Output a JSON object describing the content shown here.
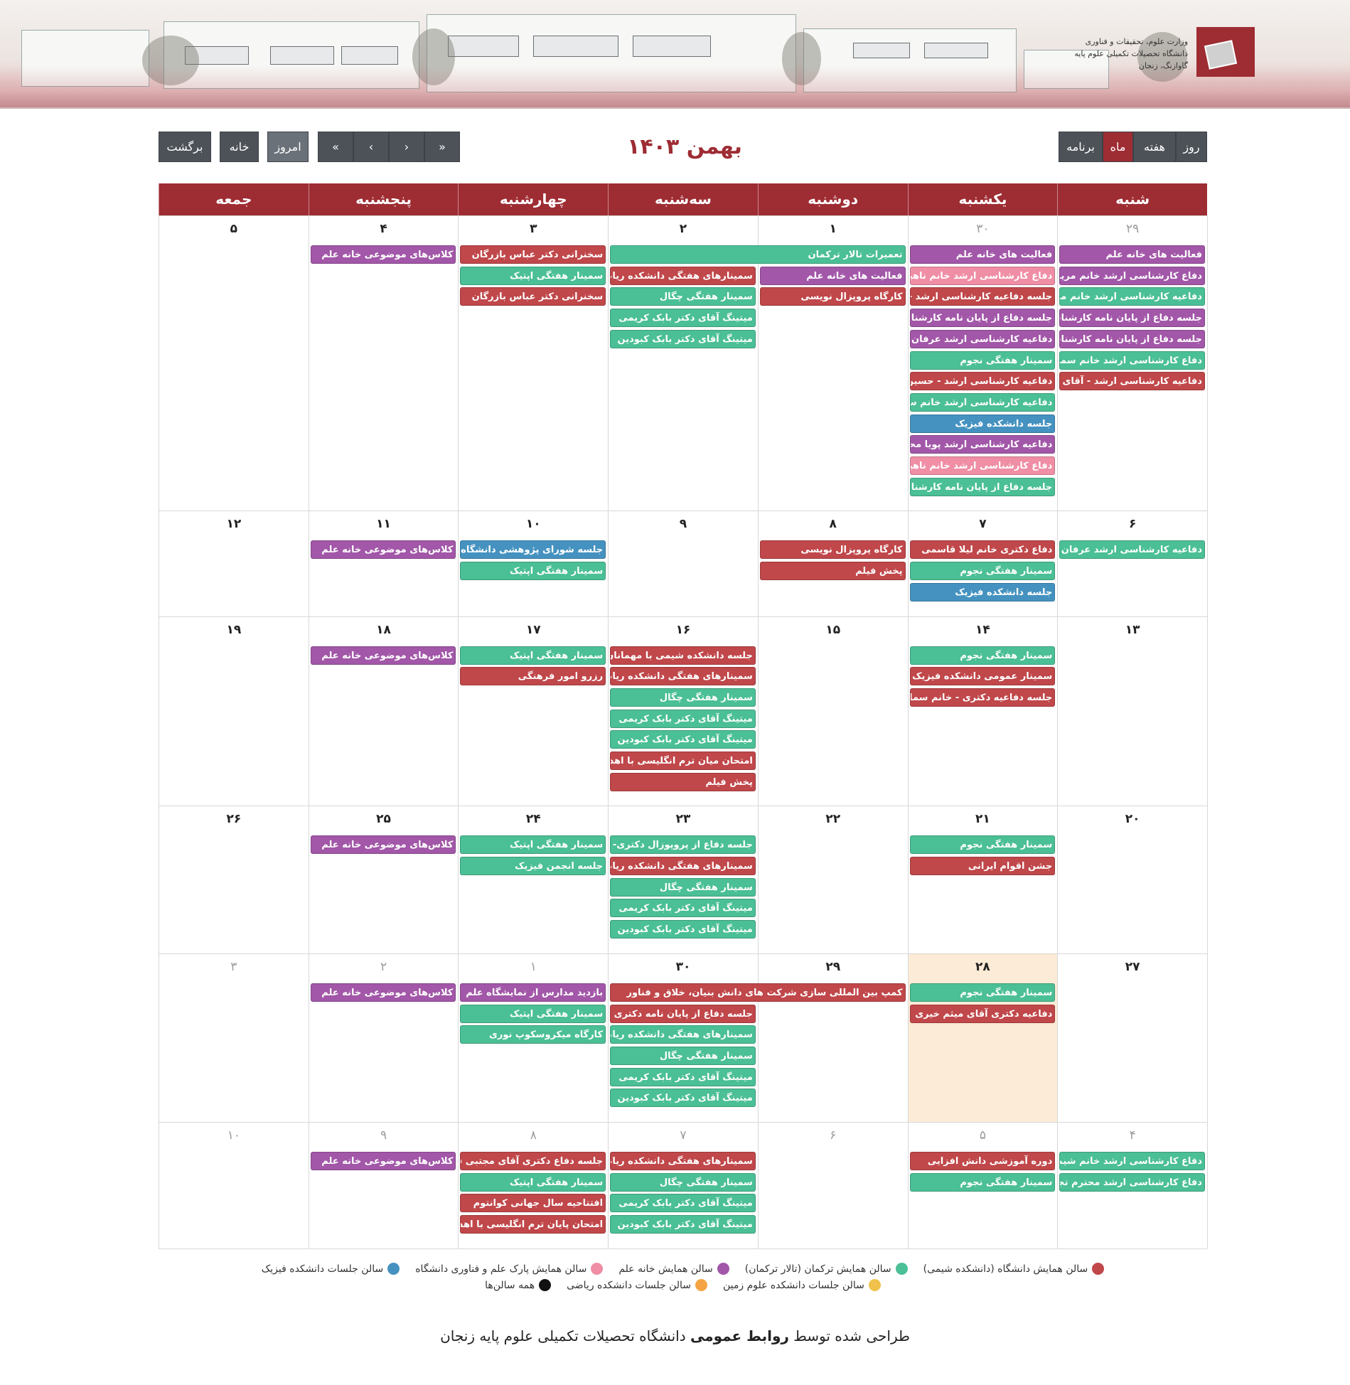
{
  "header": {
    "logo_lines": [
      "وزارت علوم، تحقیقات و فناوری",
      "دانشگاه تحصیلات تکمیلی علوم پایه",
      "گاوازنگ، زنجان"
    ]
  },
  "toolbar": {
    "views": [
      "روز",
      "هفته",
      "ماه",
      "برنامه"
    ],
    "active_view": "ماه",
    "title": "۱۴۰۳ بهمن",
    "nav": [
      "«",
      "‹",
      "›",
      "»"
    ],
    "today_label": "امروز",
    "home_label": "خانه",
    "back_label": "برگشت"
  },
  "calendar": {
    "weekdays": [
      "شنبه",
      "یکشنبه",
      "دوشنبه",
      "سه‌شنبه",
      "چهارشنبه",
      "پنجشنبه",
      "جمعه"
    ],
    "weeks": [
      {
        "days": [
          "۲۹",
          "۳۰",
          "۱",
          "۲",
          "۳",
          "۴",
          "۵"
        ],
        "other": [
          true,
          true,
          false,
          false,
          false,
          false,
          false
        ],
        "rows": 12,
        "events": [
          {
            "col": 0,
            "row": 0,
            "span": 1,
            "color": "purple",
            "text": "فعالیت های خانه علم"
          },
          {
            "col": 0,
            "row": 1,
            "span": 1,
            "color": "purple",
            "text": "دفاع کارشناسی ارشد خانم مریم حی"
          },
          {
            "col": 0,
            "row": 2,
            "span": 1,
            "color": "green",
            "text": "دفاعیه کارشناسی ارشد خانم مژگان"
          },
          {
            "col": 0,
            "row": 3,
            "span": 1,
            "color": "purple",
            "text": "جلسه دفاع از پایان نامه کارشناسی"
          },
          {
            "col": 0,
            "row": 4,
            "span": 1,
            "color": "purple",
            "text": "جلسه دفاع از پایان نامه کارشناسی"
          },
          {
            "col": 0,
            "row": 5,
            "span": 1,
            "color": "green",
            "text": "دفاع کارشناسی ارشد خانم سمیرا فت"
          },
          {
            "col": 0,
            "row": 6,
            "span": 1,
            "color": "red",
            "text": "دفاعیه کارشناسی ارشد - آقای احمد"
          },
          {
            "col": 1,
            "row": 0,
            "span": 1,
            "color": "purple",
            "text": "فعالیت های خانه علم"
          },
          {
            "col": 1,
            "row": 1,
            "span": 1,
            "color": "pink",
            "text": "دفاع کارشناسی ارشد خانم ناهید فر"
          },
          {
            "col": 1,
            "row": 2,
            "span": 1,
            "color": "red",
            "text": "جلسه دفاعیه کارشناسی ارشد - خان"
          },
          {
            "col": 1,
            "row": 3,
            "span": 1,
            "color": "purple",
            "text": "جلسه دفاع از پایان نامه کارشناسی"
          },
          {
            "col": 1,
            "row": 4,
            "span": 1,
            "color": "purple",
            "text": "دفاعیه کارشناسی ارشد عرفان محمد"
          },
          {
            "col": 1,
            "row": 5,
            "span": 1,
            "color": "green",
            "text": "سمینار هفتگی نجوم"
          },
          {
            "col": 1,
            "row": 6,
            "span": 1,
            "color": "red",
            "text": "دفاعیه کارشناسی ارشد - حسین اله"
          },
          {
            "col": 1,
            "row": 7,
            "span": 1,
            "color": "green",
            "text": "دفاعیه کارشناسی ارشد خانم سمیه"
          },
          {
            "col": 1,
            "row": 8,
            "span": 1,
            "color": "blue",
            "text": "جلسه دانشکده فیزیک"
          },
          {
            "col": 1,
            "row": 9,
            "span": 1,
            "color": "purple",
            "text": "دفاعیه کارشناسی ارشد پویا محمدی"
          },
          {
            "col": 1,
            "row": 10,
            "span": 1,
            "color": "pink",
            "text": "دفاع کارشناسی ارشد خانم ناهید فا"
          },
          {
            "col": 1,
            "row": 11,
            "span": 1,
            "color": "green",
            "text": "جلسه دفاع از پایان نامه کارشناسی"
          },
          {
            "col": 2,
            "row": 0,
            "span": 2,
            "color": "green",
            "text": "تعمیرات تالار ترکمان"
          },
          {
            "col": 2,
            "row": 1,
            "span": 1,
            "color": "purple",
            "text": "فعالیت های خانه علم"
          },
          {
            "col": 2,
            "row": 2,
            "span": 1,
            "color": "red",
            "text": "کارگاه پروپزال نویسی"
          },
          {
            "col": 3,
            "row": 1,
            "span": 1,
            "color": "red",
            "text": "سمینارهای هفتگی دانشکده ریاضی"
          },
          {
            "col": 3,
            "row": 2,
            "span": 1,
            "color": "green",
            "text": "سمینار هفتگی چگال"
          },
          {
            "col": 3,
            "row": 3,
            "span": 1,
            "color": "green",
            "text": "میتینگ آقای دکتر بابک کریمی"
          },
          {
            "col": 3,
            "row": 4,
            "span": 1,
            "color": "green",
            "text": "میتینگ آقای دکتر بابک کبودین"
          },
          {
            "col": 4,
            "row": 0,
            "span": 1,
            "color": "red",
            "text": "سخنرانی دکتر عباس بازرگان"
          },
          {
            "col": 4,
            "row": 1,
            "span": 1,
            "color": "green",
            "text": "سمینار هفتگی اپتیک"
          },
          {
            "col": 4,
            "row": 2,
            "span": 1,
            "color": "red",
            "text": "سخنرانی دکتر عباس بازرگان"
          },
          {
            "col": 5,
            "row": 0,
            "span": 1,
            "color": "purple",
            "text": "کلاس‌های موضوعی خانه علم"
          }
        ]
      },
      {
        "days": [
          "۶",
          "۷",
          "۸",
          "۹",
          "۱۰",
          "۱۱",
          "۱۲"
        ],
        "other": [
          false,
          false,
          false,
          false,
          false,
          false,
          false
        ],
        "rows": 3,
        "events": [
          {
            "col": 0,
            "row": 0,
            "span": 1,
            "color": "green",
            "text": "دفاعیه کارشناسی ارشد عرفان محمد"
          },
          {
            "col": 1,
            "row": 0,
            "span": 1,
            "color": "red",
            "text": "دفاع دکتری خانم لیلا قاسمی"
          },
          {
            "col": 1,
            "row": 1,
            "span": 1,
            "color": "green",
            "text": "سمینار هفتگی نجوم"
          },
          {
            "col": 1,
            "row": 2,
            "span": 1,
            "color": "blue",
            "text": "جلسه دانشکده فیزیک"
          },
          {
            "col": 2,
            "row": 0,
            "span": 1,
            "color": "red",
            "text": "کارگاه پروپزال نویسی"
          },
          {
            "col": 2,
            "row": 1,
            "span": 1,
            "color": "red",
            "text": "پخش فیلم"
          },
          {
            "col": 4,
            "row": 0,
            "span": 1,
            "color": "blue",
            "text": "جلسه شورای پژوهشی دانشگاه"
          },
          {
            "col": 4,
            "row": 1,
            "span": 1,
            "color": "green",
            "text": "سمینار هفتگی اپتیک"
          },
          {
            "col": 5,
            "row": 0,
            "span": 1,
            "color": "purple",
            "text": "کلاس‌های موضوعی خانه علم"
          }
        ]
      },
      {
        "days": [
          "۱۳",
          "۱۴",
          "۱۵",
          "۱۶",
          "۱۷",
          "۱۸",
          "۱۹"
        ],
        "other": [
          false,
          false,
          false,
          false,
          false,
          false,
          false
        ],
        "rows": 7,
        "events": [
          {
            "col": 1,
            "row": 0,
            "span": 1,
            "color": "green",
            "text": "سمینار هفتگی نجوم"
          },
          {
            "col": 1,
            "row": 1,
            "span": 1,
            "color": "red",
            "text": "سمینار عمومی دانشکده فیزیک"
          },
          {
            "col": 1,
            "row": 2,
            "span": 1,
            "color": "red",
            "text": "جلسه دفاعیه دکتری - خانم سمانه"
          },
          {
            "col": 3,
            "row": 0,
            "span": 1,
            "color": "red",
            "text": "جلسه دانشکده شیمی با مهمانان م"
          },
          {
            "col": 3,
            "row": 1,
            "span": 1,
            "color": "red",
            "text": "سمینارهای هفتگی دانشکده ریاضی"
          },
          {
            "col": 3,
            "row": 2,
            "span": 1,
            "color": "green",
            "text": "سمینار هفتگی چگال"
          },
          {
            "col": 3,
            "row": 3,
            "span": 1,
            "color": "green",
            "text": "میتینگ آقای دکتر بابک کریمی"
          },
          {
            "col": 3,
            "row": 4,
            "span": 1,
            "color": "green",
            "text": "میتینگ آقای دکتر بابک کبودین"
          },
          {
            "col": 3,
            "row": 5,
            "span": 1,
            "color": "red",
            "text": "امتحان میان ترم انگلیسی با اهداف"
          },
          {
            "col": 3,
            "row": 6,
            "span": 1,
            "color": "red",
            "text": "پخش فیلم"
          },
          {
            "col": 4,
            "row": 0,
            "span": 1,
            "color": "green",
            "text": "سمینار هفتگی اپتیک"
          },
          {
            "col": 4,
            "row": 1,
            "span": 1,
            "color": "red",
            "text": "رزرو امور فرهنگی"
          },
          {
            "col": 5,
            "row": 0,
            "span": 1,
            "color": "purple",
            "text": "کلاس‌های موضوعی خانه علم"
          }
        ]
      },
      {
        "days": [
          "۲۰",
          "۲۱",
          "۲۲",
          "۲۳",
          "۲۴",
          "۲۵",
          "۲۶"
        ],
        "other": [
          false,
          false,
          false,
          false,
          false,
          false,
          false
        ],
        "rows": 5,
        "events": [
          {
            "col": 1,
            "row": 0,
            "span": 1,
            "color": "green",
            "text": "سمینار هفتگی نجوم"
          },
          {
            "col": 1,
            "row": 1,
            "span": 1,
            "color": "red",
            "text": "جشن اقوام ایرانی"
          },
          {
            "col": 3,
            "row": 0,
            "span": 1,
            "color": "green",
            "text": "جلسه دفاع از پروپوزال دکتری- دانش"
          },
          {
            "col": 3,
            "row": 1,
            "span": 1,
            "color": "red",
            "text": "سمینارهای هفتگی دانشکده ریاضی"
          },
          {
            "col": 3,
            "row": 2,
            "span": 1,
            "color": "green",
            "text": "سمینار هفتگی چگال"
          },
          {
            "col": 3,
            "row": 3,
            "span": 1,
            "color": "green",
            "text": "میتینگ آقای دکتر بابک کریمی"
          },
          {
            "col": 3,
            "row": 4,
            "span": 1,
            "color": "green",
            "text": "میتینگ آقای دکتر بابک کبودین"
          },
          {
            "col": 4,
            "row": 0,
            "span": 1,
            "color": "green",
            "text": "سمینار هفتگی اپتیک"
          },
          {
            "col": 4,
            "row": 1,
            "span": 1,
            "color": "green",
            "text": "جلسه انجمن فیزیک"
          },
          {
            "col": 5,
            "row": 0,
            "span": 1,
            "color": "purple",
            "text": "کلاس‌های موضوعی خانه علم"
          }
        ]
      },
      {
        "days": [
          "۲۷",
          "۲۸",
          "۲۹",
          "۳۰",
          "۱",
          "۲",
          "۳"
        ],
        "other": [
          false,
          false,
          false,
          false,
          true,
          true,
          true
        ],
        "today_col": 1,
        "rows": 6,
        "events": [
          {
            "col": 1,
            "row": 0,
            "span": 1,
            "color": "green",
            "text": "سمینار هفتگی نجوم"
          },
          {
            "col": 1,
            "row": 1,
            "span": 1,
            "color": "red",
            "text": "دفاعیه دکتری آقای میثم خیری"
          },
          {
            "col": 2,
            "row": 0,
            "span": 2,
            "color": "red",
            "text": "کمپ بین المللی سازی شرکت های دانش بنیان، خلاق و فناور"
          },
          {
            "col": 3,
            "row": 1,
            "span": 1,
            "color": "red",
            "text": "جلسه دفاع از پایان نامه دکتری خان"
          },
          {
            "col": 3,
            "row": 2,
            "span": 1,
            "color": "green",
            "text": "سمینارهای هفتگی دانشکده ریاضی"
          },
          {
            "col": 3,
            "row": 3,
            "span": 1,
            "color": "green",
            "text": "سمینار هفتگی چگال"
          },
          {
            "col": 3,
            "row": 4,
            "span": 1,
            "color": "green",
            "text": "میتینگ آقای دکتر بابک کریمی"
          },
          {
            "col": 3,
            "row": 5,
            "span": 1,
            "color": "green",
            "text": "میتینگ آقای دکتر بابک کبودین"
          },
          {
            "col": 4,
            "row": 0,
            "span": 1,
            "color": "purple",
            "text": "بازدید مدارس از نمایشگاه علم"
          },
          {
            "col": 4,
            "row": 1,
            "span": 1,
            "color": "green",
            "text": "سمینار هفتگی اپتیک"
          },
          {
            "col": 4,
            "row": 2,
            "span": 1,
            "color": "green",
            "text": "کارگاه میکروسکوپ نوری"
          },
          {
            "col": 5,
            "row": 0,
            "span": 1,
            "color": "purple",
            "text": "کلاس‌های موضوعی خانه علم"
          }
        ]
      },
      {
        "days": [
          "۴",
          "۵",
          "۶",
          "۷",
          "۸",
          "۹",
          "۱۰"
        ],
        "other": [
          true,
          true,
          true,
          true,
          true,
          true,
          true
        ],
        "rows": 4,
        "events": [
          {
            "col": 0,
            "row": 0,
            "span": 1,
            "color": "green",
            "text": "دفاع کارشناسی ارشد خانم شیما کاه"
          },
          {
            "col": 0,
            "row": 1,
            "span": 1,
            "color": "green",
            "text": "دفاع کارشناسی ارشد محترم تجعفر"
          },
          {
            "col": 1,
            "row": 0,
            "span": 1,
            "color": "red",
            "text": "دوره آموزشی دانش افزایی"
          },
          {
            "col": 1,
            "row": 1,
            "span": 1,
            "color": "green",
            "text": "سمینار هفتگی نجوم"
          },
          {
            "col": 3,
            "row": 0,
            "span": 1,
            "color": "red",
            "text": "سمینارهای هفتگی دانشکده ریاضی"
          },
          {
            "col": 3,
            "row": 1,
            "span": 1,
            "color": "green",
            "text": "سمینار هفتگی چگال"
          },
          {
            "col": 3,
            "row": 2,
            "span": 1,
            "color": "green",
            "text": "میتینگ آقای دکتر بابک کریمی"
          },
          {
            "col": 3,
            "row": 3,
            "span": 1,
            "color": "green",
            "text": "میتینگ آقای دکتر بابک کبودین"
          },
          {
            "col": 4,
            "row": 0,
            "span": 1,
            "color": "red",
            "text": "جلسه دفاع دکتری آقای مجتبی قشا"
          },
          {
            "col": 4,
            "row": 1,
            "span": 1,
            "color": "green",
            "text": "سمینار هفتگی اپتیک"
          },
          {
            "col": 4,
            "row": 2,
            "span": 1,
            "color": "red",
            "text": "افتتاحیه سال جهانی کوانتوم"
          },
          {
            "col": 4,
            "row": 3,
            "span": 1,
            "color": "red",
            "text": "امتحان پایان ترم انگلیسی با اهداف"
          },
          {
            "col": 5,
            "row": 0,
            "span": 1,
            "color": "purple",
            "text": "کلاس‌های موضوعی خانه علم"
          }
        ]
      }
    ]
  },
  "legend": {
    "row1": [
      {
        "color": "#c0474a",
        "label": "سالن همایش دانشگاه (دانشکده شیمی)"
      },
      {
        "color": "#4bbf95",
        "label": "سالن همایش ترکمان (تالار ترکمان)"
      },
      {
        "color": "#a257a8",
        "label": "سالن همایش خانه علم"
      },
      {
        "color": "#ef8ea5",
        "label": "سالن همایش پارک علم و فناوری دانشگاه"
      },
      {
        "color": "#4592c0",
        "label": "سالن جلسات دانشکده فیزیک"
      }
    ],
    "row2": [
      {
        "color": "#f0c14b",
        "label": "سالن جلسات دانشکده علوم زمین"
      },
      {
        "color": "#f5a444",
        "label": "سالن جلسات دانشکده ریاضی"
      },
      {
        "color": "#111111",
        "label": "همه سالن‌ها"
      }
    ]
  },
  "footer": {
    "prefix": "طراحی شده توسط",
    "bold": "روابط عمومی",
    "suffix": "دانشگاه تحصیلات تکمیلی علوم پایه زنجان"
  }
}
